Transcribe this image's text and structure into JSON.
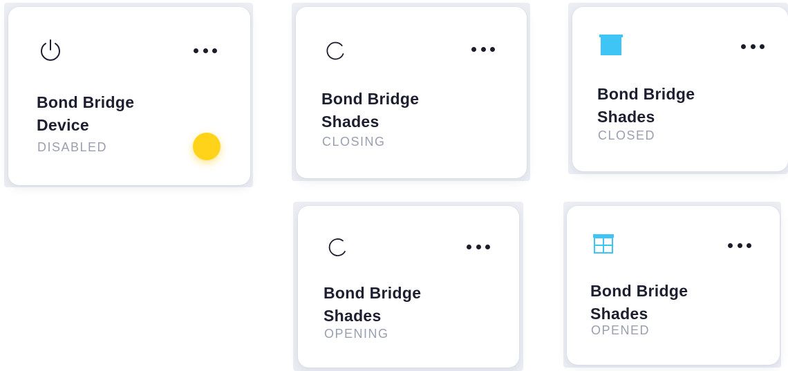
{
  "colors": {
    "card_bg": "#ffffff",
    "outer_bg": "#eceef4",
    "text_dark": "#1d1f30",
    "text_muted": "#9a9fb0",
    "toggle_yellow": "#ffd31a",
    "shade_blue": "#3ec5f5"
  },
  "cards": [
    {
      "icon": "power-icon",
      "name_line1": "Bond Bridge",
      "name_line2": "Device",
      "status": "DISABLED",
      "has_toggle": true
    },
    {
      "icon": "loading-spinner-icon",
      "name_line1": "Bond Bridge",
      "name_line2": "Shades",
      "status": "CLOSING"
    },
    {
      "icon": "shade-closed-icon",
      "name_line1": "Bond Bridge",
      "name_line2": "Shades",
      "status": "CLOSED"
    },
    {
      "icon": "loading-spinner-icon",
      "name_line1": "Bond Bridge",
      "name_line2": "Shades",
      "status": "OPENING"
    },
    {
      "icon": "shade-opened-icon",
      "name_line1": "Bond Bridge",
      "name_line2": "Shades",
      "status": "OPENED"
    }
  ]
}
